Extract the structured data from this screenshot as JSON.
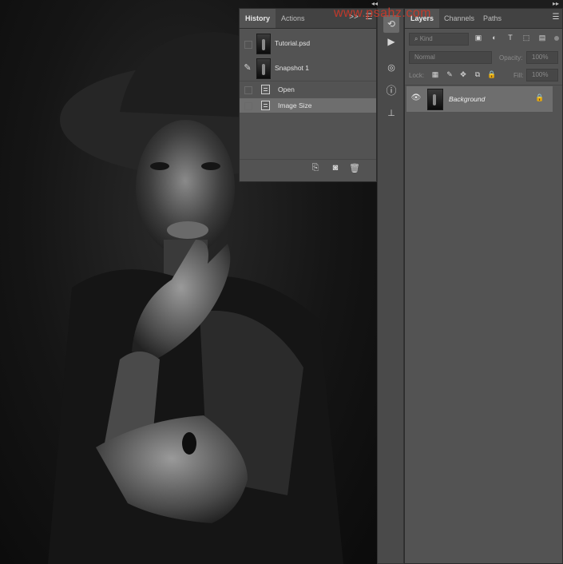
{
  "history_panel": {
    "tabs": [
      "History",
      "Actions"
    ],
    "expand_glyph": ">>",
    "snapshots": [
      {
        "label": "Tutorial.psd"
      },
      {
        "label": "Snapshot 1"
      }
    ],
    "states": [
      {
        "label": "Open"
      },
      {
        "label": "Image Size"
      }
    ],
    "footer_icons": [
      "new-document-from-state-icon",
      "camera-icon",
      "trash-icon"
    ]
  },
  "tool_strip": {
    "icons": [
      "history-brush-icon",
      "play-icon",
      "adjustments-icon",
      "info-icon",
      "clone-source-icon"
    ],
    "glyphs": {
      "play": "▶",
      "info": "ⓘ"
    }
  },
  "layers_panel": {
    "tabs": [
      "Layers",
      "Channels",
      "Paths"
    ],
    "filter_label": "Kind",
    "blend_mode": "Normal",
    "opacity_label": "Opacity:",
    "opacity_value": "100%",
    "lock_label": "Lock:",
    "fill_label": "Fill:",
    "fill_value": "100%",
    "layers": [
      {
        "name": "Background",
        "visible": true,
        "locked": true
      }
    ]
  },
  "watermark": "www.psahz.com",
  "colors": {
    "panel": "#535353",
    "tabbar": "#424242",
    "selected_row": "#6e6e6e",
    "watermark": "#c0392b"
  }
}
